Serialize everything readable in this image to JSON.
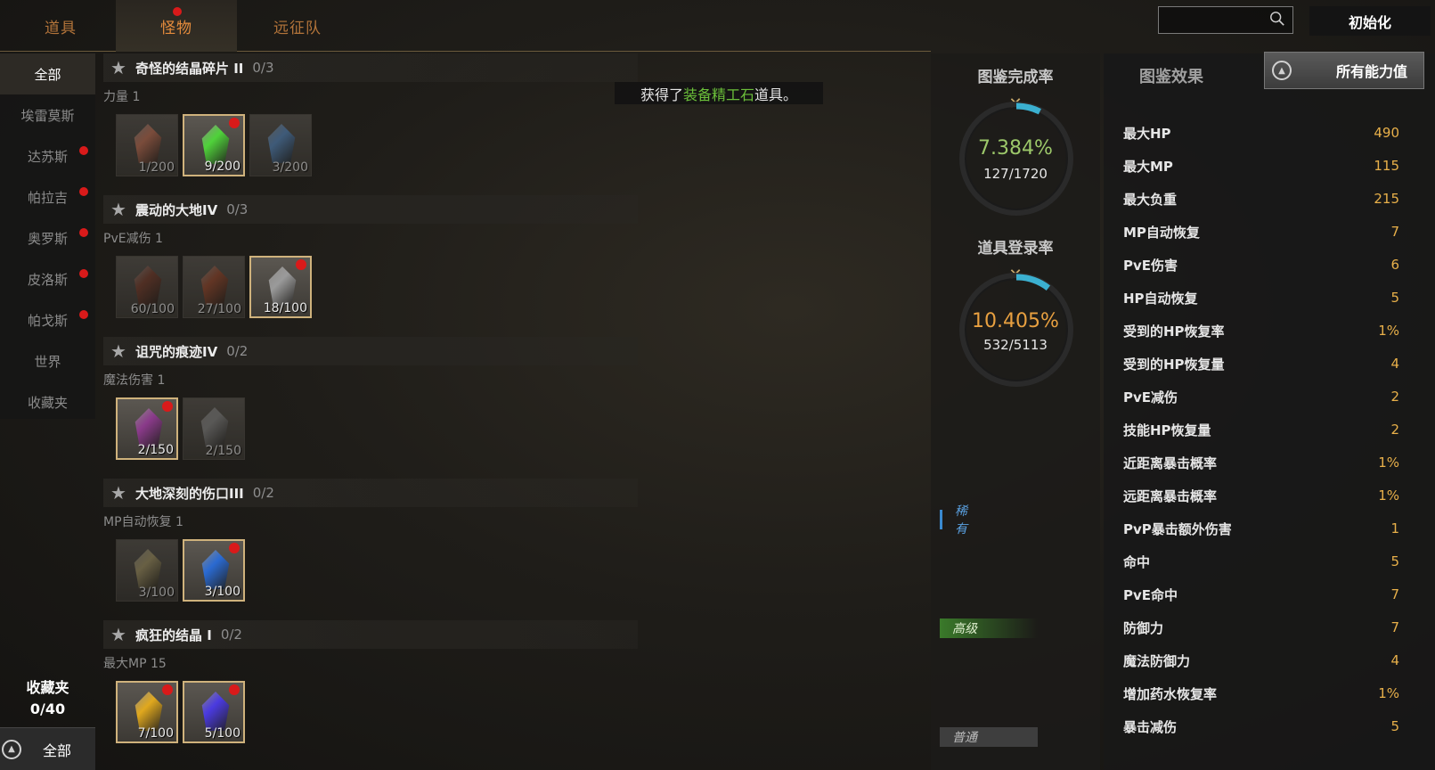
{
  "tabs": [
    {
      "label": "道具",
      "active": false,
      "alert": false
    },
    {
      "label": "怪物",
      "active": true,
      "alert": true
    },
    {
      "label": "远征队",
      "active": false,
      "alert": false
    }
  ],
  "search": {
    "placeholder": ""
  },
  "reset_label": "初始化",
  "sidebar": {
    "items": [
      {
        "label": "全部",
        "active": true,
        "alert": false
      },
      {
        "label": "埃雷莫斯",
        "active": false,
        "alert": false
      },
      {
        "label": "达苏斯",
        "active": false,
        "alert": true
      },
      {
        "label": "帕拉吉",
        "active": false,
        "alert": true
      },
      {
        "label": "奥罗斯",
        "active": false,
        "alert": true
      },
      {
        "label": "皮洛斯",
        "active": false,
        "alert": true
      },
      {
        "label": "帕戈斯",
        "active": false,
        "alert": true
      },
      {
        "label": "世界",
        "active": false,
        "alert": false
      },
      {
        "label": "收藏夹",
        "active": false,
        "alert": false
      }
    ],
    "favorites_label": "收藏夹",
    "favorites_count": "0/40",
    "bottom_label": "全部"
  },
  "notice": {
    "prefix": "获得了",
    "highlight": "装备精工石",
    "suffix": "道具。"
  },
  "entries": [
    {
      "title": "奇怪的结晶碎片 II",
      "count": "0/3",
      "stat": "力量 1",
      "slots": [
        {
          "qty": "1/200",
          "owned": false,
          "alert": false,
          "color": "#c9765a"
        },
        {
          "qty": "9/200",
          "owned": true,
          "alert": true,
          "color": "#4fd23a"
        },
        {
          "qty": "3/200",
          "owned": false,
          "alert": false,
          "color": "#5a8fc9"
        }
      ]
    },
    {
      "title": "震动的大地IV",
      "count": "0/3",
      "stat": "PvE减伤 1",
      "slots": [
        {
          "qty": "60/100",
          "owned": false,
          "alert": false,
          "color": "#7a3f2e"
        },
        {
          "qty": "27/100",
          "owned": false,
          "alert": false,
          "color": "#9a4a2e"
        },
        {
          "qty": "18/100",
          "owned": true,
          "alert": true,
          "color": "#9a9a9a"
        }
      ]
    },
    {
      "title": "诅咒的痕迹IV",
      "count": "0/2",
      "stat": "魔法伤害 1",
      "slots": [
        {
          "qty": "2/150",
          "owned": true,
          "alert": true,
          "color": "#8a3a8a"
        },
        {
          "qty": "2/150",
          "owned": false,
          "alert": false,
          "color": "#8a8a8a"
        }
      ]
    },
    {
      "title": "大地深刻的伤口III",
      "count": "0/2",
      "stat": "MP自动恢复 1",
      "slots": [
        {
          "qty": "3/100",
          "owned": false,
          "alert": false,
          "color": "#a89a6a"
        },
        {
          "qty": "3/100",
          "owned": true,
          "alert": true,
          "color": "#2a6ad2"
        }
      ]
    },
    {
      "title": "疯狂的结晶 I",
      "count": "0/2",
      "stat": "最大MP 15",
      "slots": [
        {
          "qty": "7/100",
          "owned": true,
          "alert": true,
          "color": "#e0a81e"
        },
        {
          "qty": "5/100",
          "owned": true,
          "alert": true,
          "color": "#4a3ae0"
        }
      ]
    }
  ],
  "completion": {
    "title": "图鉴完成率",
    "percent": "7.384%",
    "fraction": "127/1720",
    "value": 0.07384,
    "color": "#9cc86a"
  },
  "registration": {
    "title": "道具登录率",
    "percent": "10.405%",
    "fraction": "532/5113",
    "value": 0.10405,
    "color": "#e8a040"
  },
  "grades": [
    {
      "label": "稀有",
      "color": "#3a8ad0"
    },
    {
      "label": "高级",
      "color": "#5aa83a"
    },
    {
      "label": "普通",
      "color": "#8a8a8a"
    }
  ],
  "effect": {
    "title": "图鉴效果",
    "all_label": "所有能力值",
    "stats": [
      {
        "name": "最大HP",
        "value": "490"
      },
      {
        "name": "最大MP",
        "value": "115"
      },
      {
        "name": "最大负重",
        "value": "215"
      },
      {
        "name": "MP自动恢复",
        "value": "7"
      },
      {
        "name": "PvE伤害",
        "value": "6"
      },
      {
        "name": "HP自动恢复",
        "value": "5"
      },
      {
        "name": "受到的HP恢复率",
        "value": "1%"
      },
      {
        "name": "受到的HP恢复量",
        "value": "4"
      },
      {
        "name": "PvE减伤",
        "value": "2"
      },
      {
        "name": "技能HP恢复量",
        "value": "2"
      },
      {
        "name": "近距离暴击概率",
        "value": "1%"
      },
      {
        "name": "远距离暴击概率",
        "value": "1%"
      },
      {
        "name": "PvP暴击额外伤害",
        "value": "1"
      },
      {
        "name": "命中",
        "value": "5"
      },
      {
        "name": "PvE命中",
        "value": "7"
      },
      {
        "name": "防御力",
        "value": "7"
      },
      {
        "name": "魔法防御力",
        "value": "4"
      },
      {
        "name": "增加药水恢复率",
        "value": "1%"
      },
      {
        "name": "暴击减伤",
        "value": "5"
      }
    ]
  }
}
